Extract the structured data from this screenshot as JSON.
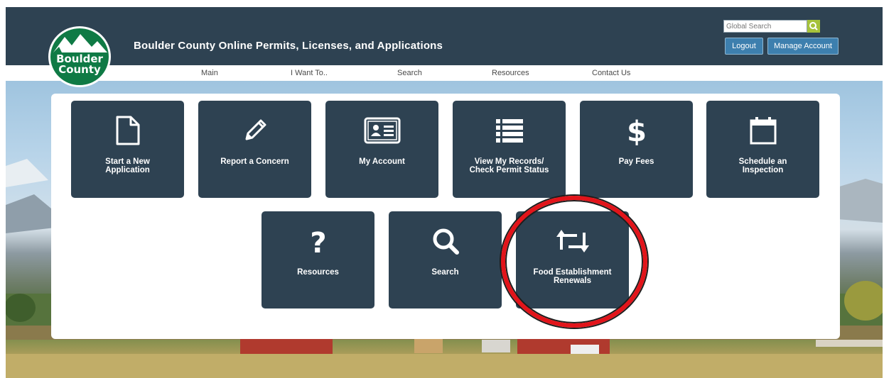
{
  "header": {
    "logo_line1": "Boulder",
    "logo_line2": "County",
    "title": "Boulder County Online Permits, Licenses, and Applications",
    "search_placeholder": "Global Search",
    "logout_label": "Logout",
    "manage_label": "Manage Account"
  },
  "nav": {
    "items": [
      "Main",
      "I Want To..",
      "Search",
      "Resources",
      "Contact Us"
    ]
  },
  "tiles": [
    {
      "label1": "Start a New",
      "label2": "Application",
      "icon": "document-icon"
    },
    {
      "label1": "Report a Concern",
      "label2": "",
      "icon": "pencil-icon"
    },
    {
      "label1": "My Account",
      "label2": "",
      "icon": "id-card-icon"
    },
    {
      "label1": "View My Records/",
      "label2": "Check Permit Status",
      "icon": "list-icon"
    },
    {
      "label1": "Pay Fees",
      "label2": "",
      "icon": "dollar-icon"
    },
    {
      "label1": "Schedule an",
      "label2": "Inspection",
      "icon": "calendar-icon"
    },
    {
      "label1": "Resources",
      "label2": "",
      "icon": "question-icon"
    },
    {
      "label1": "Search",
      "label2": "",
      "icon": "magnifier-icon"
    },
    {
      "label1": "Food Establishment",
      "label2": "Renewals",
      "icon": "renew-icon"
    }
  ],
  "colors": {
    "header_bg": "#2e4252",
    "tile_bg": "#2e4252",
    "button_bg": "#3d7fae",
    "search_btn": "#a6c23a",
    "logo_green": "#0f7a45",
    "highlight": "#e2141a"
  }
}
